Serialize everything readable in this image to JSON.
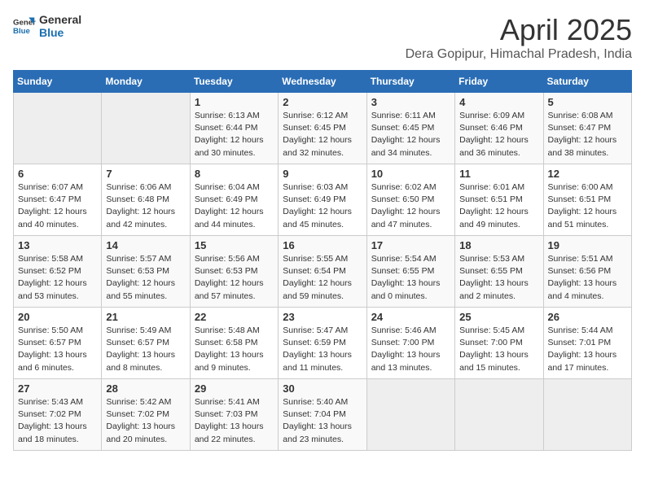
{
  "logo": {
    "line1": "General",
    "line2": "Blue"
  },
  "title": "April 2025",
  "location": "Dera Gopipur, Himachal Pradesh, India",
  "days_of_week": [
    "Sunday",
    "Monday",
    "Tuesday",
    "Wednesday",
    "Thursday",
    "Friday",
    "Saturday"
  ],
  "weeks": [
    [
      {
        "day": "",
        "info": ""
      },
      {
        "day": "",
        "info": ""
      },
      {
        "day": "1",
        "info": "Sunrise: 6:13 AM\nSunset: 6:44 PM\nDaylight: 12 hours\nand 30 minutes."
      },
      {
        "day": "2",
        "info": "Sunrise: 6:12 AM\nSunset: 6:45 PM\nDaylight: 12 hours\nand 32 minutes."
      },
      {
        "day": "3",
        "info": "Sunrise: 6:11 AM\nSunset: 6:45 PM\nDaylight: 12 hours\nand 34 minutes."
      },
      {
        "day": "4",
        "info": "Sunrise: 6:09 AM\nSunset: 6:46 PM\nDaylight: 12 hours\nand 36 minutes."
      },
      {
        "day": "5",
        "info": "Sunrise: 6:08 AM\nSunset: 6:47 PM\nDaylight: 12 hours\nand 38 minutes."
      }
    ],
    [
      {
        "day": "6",
        "info": "Sunrise: 6:07 AM\nSunset: 6:47 PM\nDaylight: 12 hours\nand 40 minutes."
      },
      {
        "day": "7",
        "info": "Sunrise: 6:06 AM\nSunset: 6:48 PM\nDaylight: 12 hours\nand 42 minutes."
      },
      {
        "day": "8",
        "info": "Sunrise: 6:04 AM\nSunset: 6:49 PM\nDaylight: 12 hours\nand 44 minutes."
      },
      {
        "day": "9",
        "info": "Sunrise: 6:03 AM\nSunset: 6:49 PM\nDaylight: 12 hours\nand 45 minutes."
      },
      {
        "day": "10",
        "info": "Sunrise: 6:02 AM\nSunset: 6:50 PM\nDaylight: 12 hours\nand 47 minutes."
      },
      {
        "day": "11",
        "info": "Sunrise: 6:01 AM\nSunset: 6:51 PM\nDaylight: 12 hours\nand 49 minutes."
      },
      {
        "day": "12",
        "info": "Sunrise: 6:00 AM\nSunset: 6:51 PM\nDaylight: 12 hours\nand 51 minutes."
      }
    ],
    [
      {
        "day": "13",
        "info": "Sunrise: 5:58 AM\nSunset: 6:52 PM\nDaylight: 12 hours\nand 53 minutes."
      },
      {
        "day": "14",
        "info": "Sunrise: 5:57 AM\nSunset: 6:53 PM\nDaylight: 12 hours\nand 55 minutes."
      },
      {
        "day": "15",
        "info": "Sunrise: 5:56 AM\nSunset: 6:53 PM\nDaylight: 12 hours\nand 57 minutes."
      },
      {
        "day": "16",
        "info": "Sunrise: 5:55 AM\nSunset: 6:54 PM\nDaylight: 12 hours\nand 59 minutes."
      },
      {
        "day": "17",
        "info": "Sunrise: 5:54 AM\nSunset: 6:55 PM\nDaylight: 13 hours\nand 0 minutes."
      },
      {
        "day": "18",
        "info": "Sunrise: 5:53 AM\nSunset: 6:55 PM\nDaylight: 13 hours\nand 2 minutes."
      },
      {
        "day": "19",
        "info": "Sunrise: 5:51 AM\nSunset: 6:56 PM\nDaylight: 13 hours\nand 4 minutes."
      }
    ],
    [
      {
        "day": "20",
        "info": "Sunrise: 5:50 AM\nSunset: 6:57 PM\nDaylight: 13 hours\nand 6 minutes."
      },
      {
        "day": "21",
        "info": "Sunrise: 5:49 AM\nSunset: 6:57 PM\nDaylight: 13 hours\nand 8 minutes."
      },
      {
        "day": "22",
        "info": "Sunrise: 5:48 AM\nSunset: 6:58 PM\nDaylight: 13 hours\nand 9 minutes."
      },
      {
        "day": "23",
        "info": "Sunrise: 5:47 AM\nSunset: 6:59 PM\nDaylight: 13 hours\nand 11 minutes."
      },
      {
        "day": "24",
        "info": "Sunrise: 5:46 AM\nSunset: 7:00 PM\nDaylight: 13 hours\nand 13 minutes."
      },
      {
        "day": "25",
        "info": "Sunrise: 5:45 AM\nSunset: 7:00 PM\nDaylight: 13 hours\nand 15 minutes."
      },
      {
        "day": "26",
        "info": "Sunrise: 5:44 AM\nSunset: 7:01 PM\nDaylight: 13 hours\nand 17 minutes."
      }
    ],
    [
      {
        "day": "27",
        "info": "Sunrise: 5:43 AM\nSunset: 7:02 PM\nDaylight: 13 hours\nand 18 minutes."
      },
      {
        "day": "28",
        "info": "Sunrise: 5:42 AM\nSunset: 7:02 PM\nDaylight: 13 hours\nand 20 minutes."
      },
      {
        "day": "29",
        "info": "Sunrise: 5:41 AM\nSunset: 7:03 PM\nDaylight: 13 hours\nand 22 minutes."
      },
      {
        "day": "30",
        "info": "Sunrise: 5:40 AM\nSunset: 7:04 PM\nDaylight: 13 hours\nand 23 minutes."
      },
      {
        "day": "",
        "info": ""
      },
      {
        "day": "",
        "info": ""
      },
      {
        "day": "",
        "info": ""
      }
    ]
  ]
}
